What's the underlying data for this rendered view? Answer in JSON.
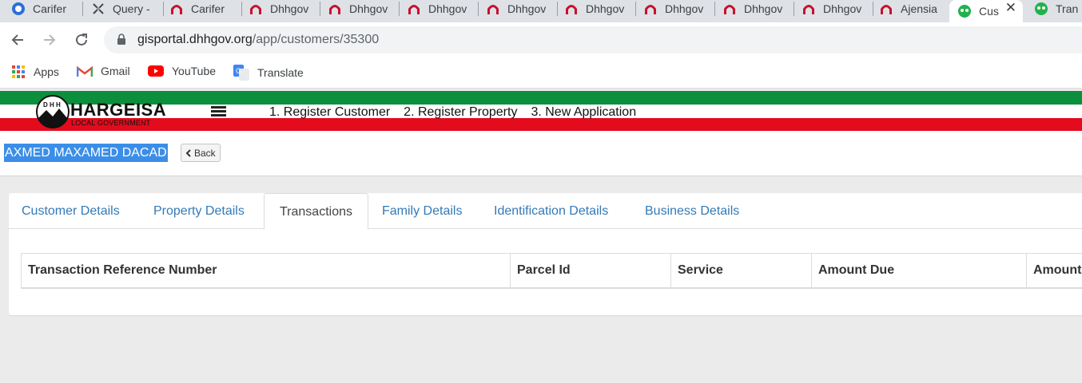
{
  "browser": {
    "tabs": [
      {
        "label": "Carifer",
        "icon": "circle-blue-icon"
      },
      {
        "label": "Query -",
        "icon": "query-x-icon"
      },
      {
        "label": "Carifer",
        "icon": "arch-red-icon"
      },
      {
        "label": "Dhhgov",
        "icon": "arch-red-icon"
      },
      {
        "label": "Dhhgov",
        "icon": "arch-red-icon"
      },
      {
        "label": "Dhhgov",
        "icon": "arch-red-icon"
      },
      {
        "label": "Dhhgov",
        "icon": "arch-red-icon"
      },
      {
        "label": "Dhhgov",
        "icon": "arch-red-icon"
      },
      {
        "label": "Dhhgov",
        "icon": "arch-red-icon"
      },
      {
        "label": "Dhhgov",
        "icon": "arch-red-icon"
      },
      {
        "label": "Dhhgov",
        "icon": "arch-red-icon"
      },
      {
        "label": "Ajensia",
        "icon": "arch-red-icon"
      },
      {
        "label": "Cus",
        "icon": "green-logo-icon",
        "active": true
      },
      {
        "label": "Tran",
        "icon": "green-logo-icon"
      }
    ],
    "close_glyph": "✕",
    "url_domain": "gisportal.dhhgov.org",
    "url_path": "/app/customers/35300",
    "bookmarks": [
      {
        "label": "Apps",
        "icon": "apps-grid-icon"
      },
      {
        "label": "Gmail",
        "icon": "gmail-icon"
      },
      {
        "label": "YouTube",
        "icon": "youtube-icon"
      },
      {
        "label": "Translate",
        "icon": "translate-icon"
      }
    ]
  },
  "site": {
    "logo_title": "HARGEISA",
    "logo_sub": "LOCAL GOVERNMENT",
    "logo_badge": "D H H",
    "nav": [
      "1. Register Customer",
      "2. Register Property",
      "3. New Application"
    ],
    "colors": {
      "green": "#0c8f3c",
      "red": "#e30b1c",
      "link": "#337ab7"
    }
  },
  "customer": {
    "name": "AXMED MAXAMED DACAD",
    "back_label": "Back"
  },
  "detail_tabs": [
    "Customer Details",
    "Property Details",
    "Transactions",
    "Family Details",
    "Identification Details",
    "Business Details"
  ],
  "active_tab": "Transactions",
  "table": {
    "headers": [
      "Transaction Reference Number",
      "Parcel Id",
      "Service",
      "Amount Due",
      "Amount"
    ]
  }
}
